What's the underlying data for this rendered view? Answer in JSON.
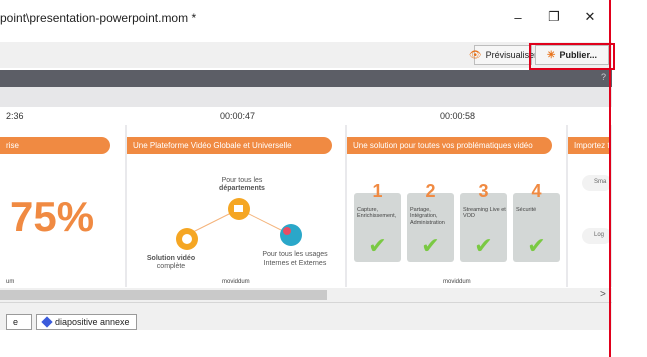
{
  "window": {
    "title": "point\\presentation-powerpoint.mom *",
    "minimize": "–",
    "maximize": "❐",
    "close": "✕"
  },
  "toolbar": {
    "preview_label": "Prévisualiser",
    "publish_label": "Publier...",
    "help_label": "?"
  },
  "timeline": {
    "times": [
      "2:36",
      "00:00:47",
      "00:00:58"
    ]
  },
  "slides": [
    {
      "banner": "rise",
      "big_number": "75%",
      "logo": "um"
    },
    {
      "banner": "Une Plateforme Vidéo Globale et Universelle",
      "top_text_1": "Pour tous les",
      "top_text_2": "départements",
      "left_text_1": "Solution vidéo",
      "left_text_2": "complète",
      "right_text_1": "Pour tous les usages",
      "right_text_2": "Internes et Externes",
      "logo": "moviddum"
    },
    {
      "banner": "Une solution pour toutes vos problématiques vidéo",
      "cards": [
        {
          "num": "1",
          "text": "Capture, Enrichissement,"
        },
        {
          "num": "2",
          "text": "Partage, Intégration, Administration"
        },
        {
          "num": "3",
          "text": "Streaming Live et VOD"
        },
        {
          "num": "4",
          "text": "Sécurité"
        }
      ],
      "logo": "moviddum"
    },
    {
      "banner": "Importez t",
      "item_1": "Sma",
      "item_2": "Log"
    }
  ],
  "scroll": {
    "right_arrow": ">"
  },
  "bottom": {
    "chip_left": "e",
    "chip_annex": "diapositive annexe"
  },
  "colors": {
    "accent_orange": "#f08a42",
    "highlight_red": "#e0001b",
    "check_green": "#7ac943",
    "annex_diamond": "#3b5bdb"
  }
}
